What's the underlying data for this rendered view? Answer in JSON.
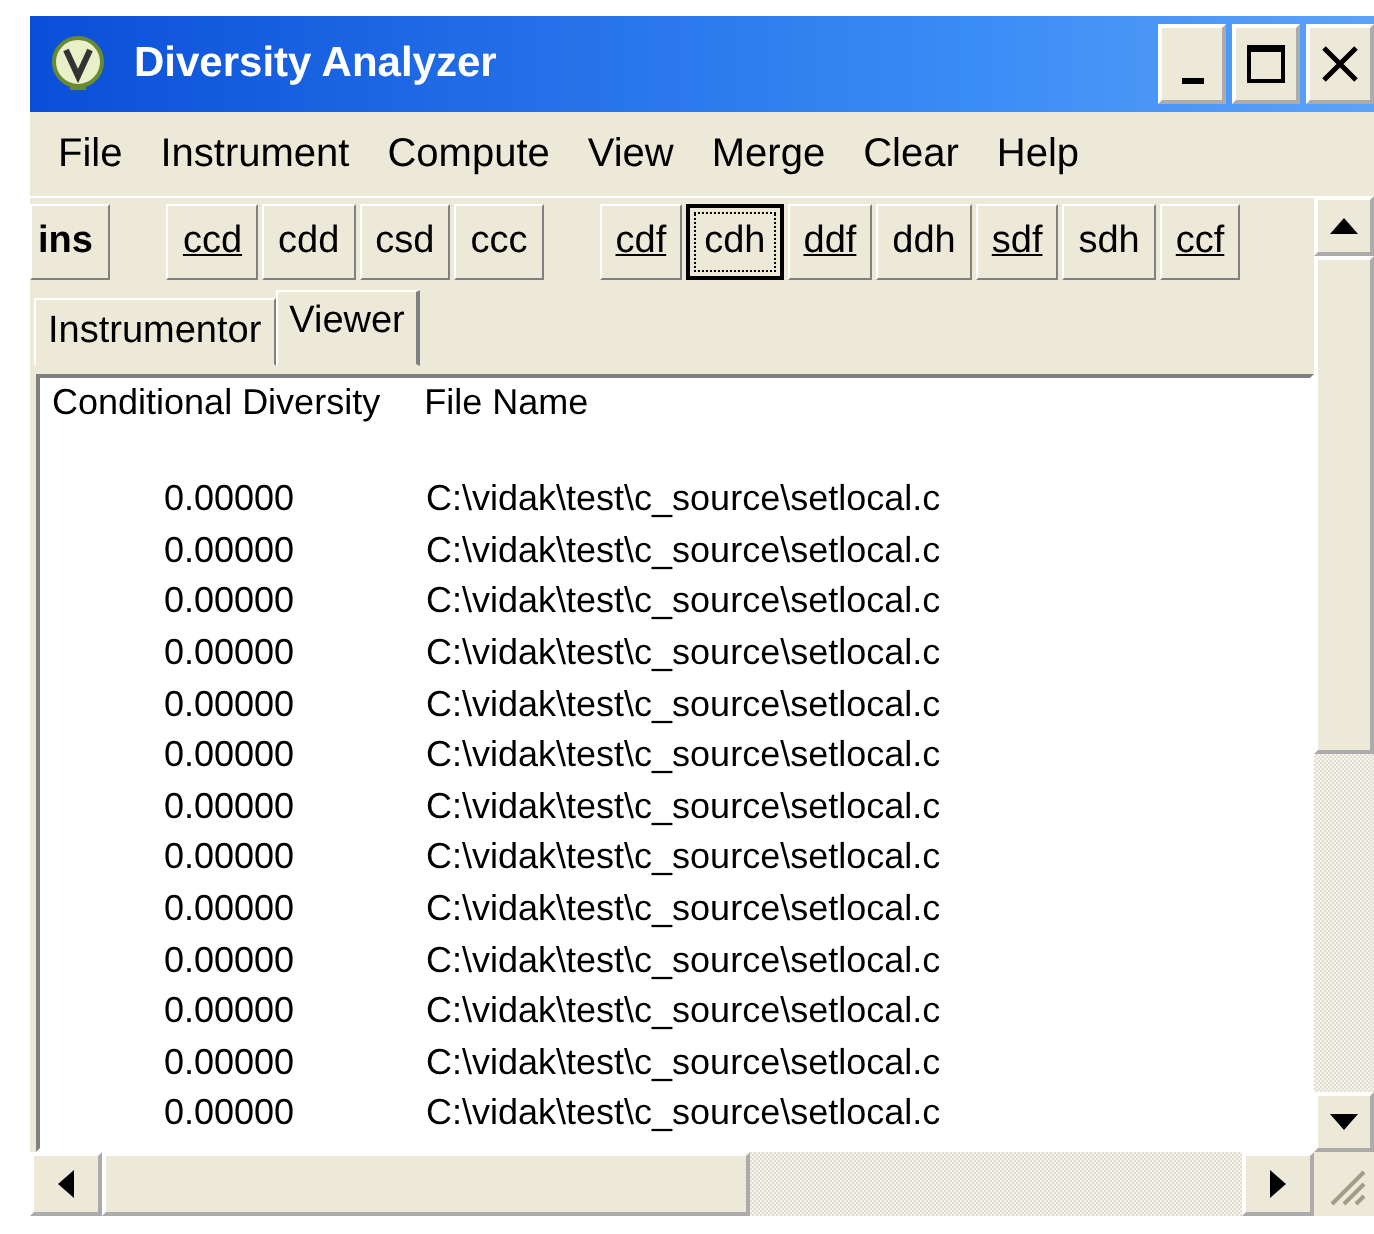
{
  "window": {
    "title": "Diversity Analyzer"
  },
  "menu": [
    "File",
    "Instrument",
    "Compute",
    "View",
    "Merge",
    "Clear",
    "Help"
  ],
  "toolbar": [
    {
      "kind": "bold",
      "label": "ins",
      "underlined": false,
      "selected": false
    },
    {
      "kind": "separator"
    },
    {
      "kind": "button",
      "label": "ccd",
      "underlined": true,
      "selected": false
    },
    {
      "kind": "button",
      "label": "cdd",
      "underlined": false,
      "selected": false
    },
    {
      "kind": "button",
      "label": "csd",
      "underlined": false,
      "selected": false
    },
    {
      "kind": "button",
      "label": "ccc",
      "underlined": false,
      "selected": false
    },
    {
      "kind": "separator"
    },
    {
      "kind": "button",
      "label": "cdf",
      "underlined": true,
      "selected": false
    },
    {
      "kind": "button",
      "label": "cdh",
      "underlined": false,
      "selected": true
    },
    {
      "kind": "button",
      "label": "ddf",
      "underlined": true,
      "selected": false
    },
    {
      "kind": "button",
      "label": "ddh",
      "underlined": false,
      "selected": false
    },
    {
      "kind": "button",
      "label": "sdf",
      "underlined": true,
      "selected": false
    },
    {
      "kind": "button",
      "label": "sdh",
      "underlined": false,
      "selected": false
    },
    {
      "kind": "button",
      "label": "ccf",
      "underlined": true,
      "selected": false
    }
  ],
  "tabs": [
    {
      "label": "Instrumentor",
      "selected": false
    },
    {
      "label": "Viewer",
      "selected": true
    }
  ],
  "table": {
    "columns": [
      "Conditional Diversity",
      "File Name"
    ],
    "rows": [
      [
        "0.00000",
        "C:\\vidak\\test\\c_source\\setlocal.c"
      ],
      [
        "0.00000",
        "C:\\vidak\\test\\c_source\\setlocal.c"
      ],
      [
        "0.00000",
        "C:\\vidak\\test\\c_source\\setlocal.c"
      ],
      [
        "0.00000",
        "C:\\vidak\\test\\c_source\\setlocal.c"
      ],
      [
        "0.00000",
        "C:\\vidak\\test\\c_source\\setlocal.c"
      ],
      [
        "0.00000",
        "C:\\vidak\\test\\c_source\\setlocal.c"
      ],
      [
        "0.00000",
        "C:\\vidak\\test\\c_source\\setlocal.c"
      ],
      [
        "0.00000",
        "C:\\vidak\\test\\c_source\\setlocal.c"
      ],
      [
        "0.00000",
        "C:\\vidak\\test\\c_source\\setlocal.c"
      ],
      [
        "0.00000",
        "C:\\vidak\\test\\c_source\\setlocal.c"
      ],
      [
        "0.00000",
        "C:\\vidak\\test\\c_source\\setlocal.c"
      ],
      [
        "0.00000",
        "C:\\vidak\\test\\c_source\\setlocal.c"
      ],
      [
        "0.00000",
        "C:\\vidak\\test\\c_source\\setlocal.c"
      ]
    ]
  }
}
